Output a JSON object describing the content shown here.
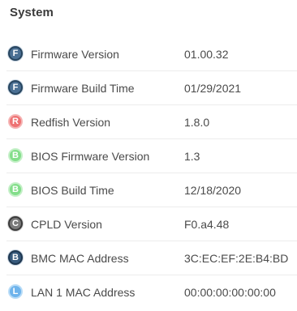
{
  "section": {
    "title": "System"
  },
  "rows": [
    {
      "icon": "firmware-icon",
      "letter": "F",
      "label": "Firmware Version",
      "value": "01.00.32"
    },
    {
      "icon": "firmware-icon",
      "letter": "F",
      "label": "Firmware Build Time",
      "value": "01/29/2021"
    },
    {
      "icon": "redfish-icon",
      "letter": "R",
      "label": "Redfish Version",
      "value": "1.8.0"
    },
    {
      "icon": "bios-icon",
      "letter": "B",
      "label": "BIOS Firmware Version",
      "value": "1.3"
    },
    {
      "icon": "bios-icon",
      "letter": "B",
      "label": "BIOS Build Time",
      "value": "12/18/2020"
    },
    {
      "icon": "cpld-icon",
      "letter": "C",
      "label": "CPLD Version",
      "value": "F0.a4.48"
    },
    {
      "icon": "bmc-icon",
      "letter": "B",
      "label": "BMC MAC Address",
      "value": "3C:EC:EF:2E:B4:BD"
    },
    {
      "icon": "lan-icon",
      "letter": "L",
      "label": "LAN 1 MAC Address",
      "value": "00:00:00:00:00:00"
    }
  ],
  "colors": {
    "firmware": "#4a6f93",
    "redfish": "#ee7273",
    "bios": "#83de8a",
    "cpld": "#7a7a7a",
    "bmc": "#36597b",
    "lan": "#6fb4ec"
  }
}
